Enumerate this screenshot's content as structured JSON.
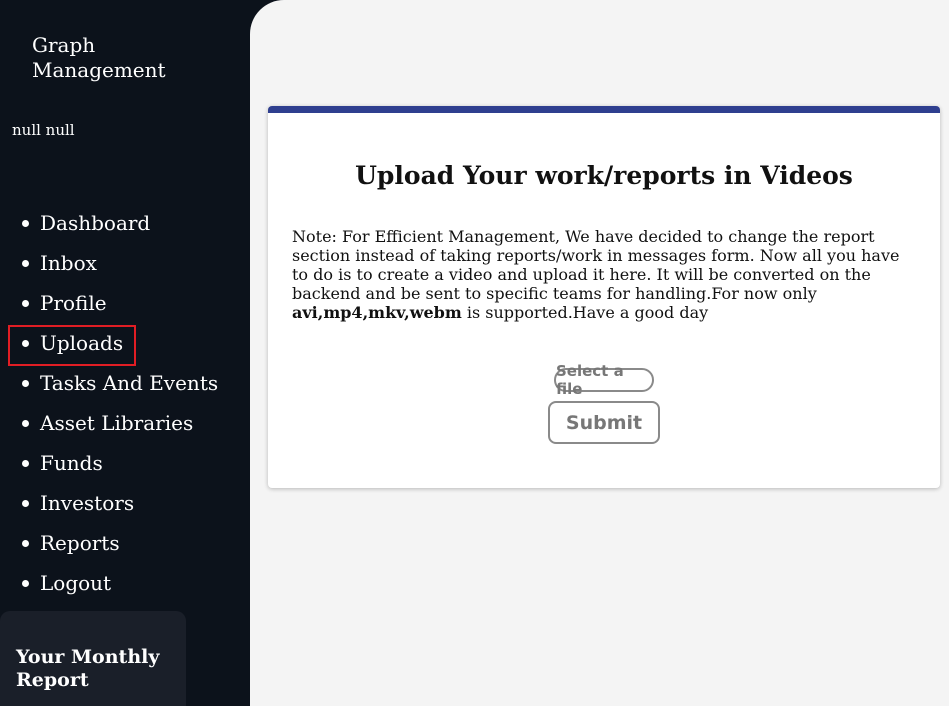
{
  "sidebar": {
    "brand": "Graph Management",
    "user_name": "null null",
    "nav": [
      {
        "label": "Dashboard"
      },
      {
        "label": "Inbox"
      },
      {
        "label": "Profile"
      },
      {
        "label": "Uploads"
      },
      {
        "label": "Tasks And Events"
      },
      {
        "label": "Asset Libraries"
      },
      {
        "label": "Funds"
      },
      {
        "label": "Investors"
      },
      {
        "label": "Reports"
      },
      {
        "label": "Logout"
      }
    ],
    "report_card_title": "Your Monthly Report"
  },
  "upload": {
    "title": "Upload Your work/reports in Videos",
    "note_text": "Note: For Efficient Management, We have decided to change the report section instead of taking reports/work in messages form. Now all you have to do is to create a video and upload it here. It will be converted on the backend and be sent to specific teams for handling.For now only ",
    "formats": "avi,mp4,mkv,webm",
    "note_suffix": " is supported.Have a good day",
    "file_button": "Select a file",
    "submit_label": "Submit"
  },
  "colors": {
    "sidebar_bg": "#0c121b",
    "card_accent": "#2f3f8f",
    "highlight_outline": "#e11d24"
  }
}
